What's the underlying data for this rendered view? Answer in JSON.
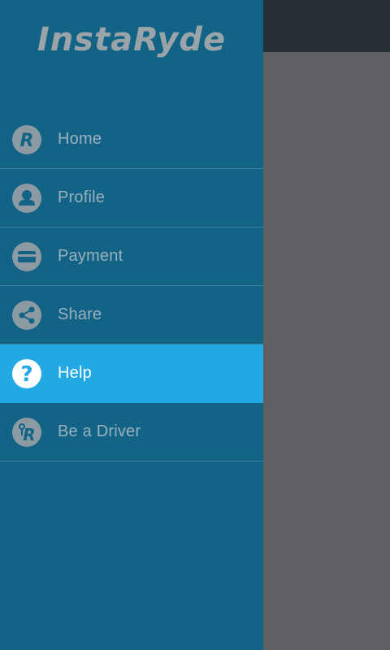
{
  "app": {
    "name": "InstaRyde"
  },
  "colors": {
    "drawer_bg": "#126386",
    "active_bg": "#22a8e2",
    "icon_gray": "#8c9ba3",
    "label_gray": "#9ab1bd",
    "overlay": "#5f6064",
    "toolbar": "#273036"
  },
  "menu": {
    "items": [
      {
        "label": "Home",
        "icon": "instaryde-r-icon",
        "active": false
      },
      {
        "label": "Profile",
        "icon": "person-icon",
        "active": false
      },
      {
        "label": "Payment",
        "icon": "credit-card-icon",
        "active": false
      },
      {
        "label": "Share",
        "icon": "share-icon",
        "active": false
      },
      {
        "label": "Help",
        "icon": "help-icon",
        "active": true
      },
      {
        "label": "Be a Driver",
        "icon": "driver-key-icon",
        "active": false
      }
    ]
  }
}
